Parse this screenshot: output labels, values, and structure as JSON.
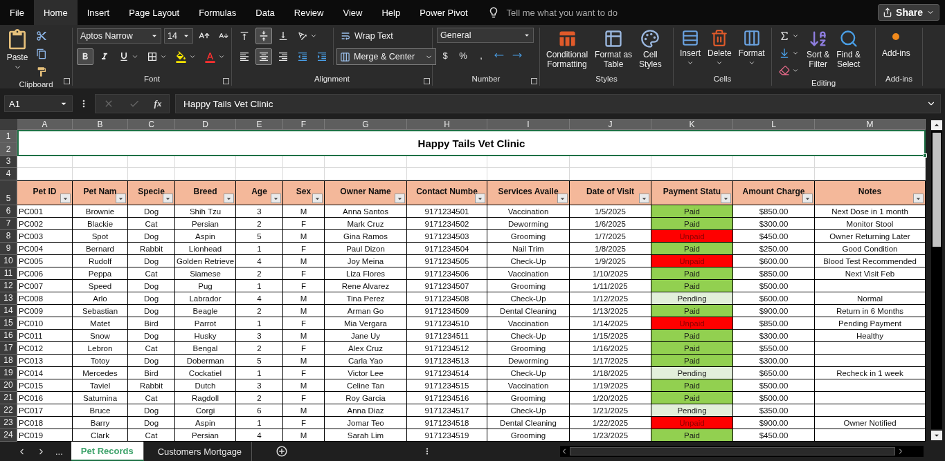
{
  "menu_tabs": [
    {
      "label": "File",
      "selected": false
    },
    {
      "label": "Home",
      "selected": true
    },
    {
      "label": "Insert",
      "selected": false
    },
    {
      "label": "Page Layout",
      "selected": false
    },
    {
      "label": "Formulas",
      "selected": false
    },
    {
      "label": "Data",
      "selected": false
    },
    {
      "label": "Review",
      "selected": false
    },
    {
      "label": "View",
      "selected": false
    },
    {
      "label": "Help",
      "selected": false
    },
    {
      "label": "Power Pivot",
      "selected": false
    }
  ],
  "tell_me": {
    "placeholder": "Tell me what you want to do"
  },
  "share_button": "Share",
  "ribbon": {
    "clipboard": {
      "label": "Clipboard",
      "paste": "Paste"
    },
    "font": {
      "label": "Font",
      "name": "Aptos Narrow",
      "size": "14",
      "bold": true,
      "italic": false,
      "underline": false
    },
    "alignment": {
      "label": "Alignment",
      "wrap_text": "Wrap Text",
      "merge": "Merge & Center",
      "vertical": [
        {
          "kind": "top",
          "selected": false
        },
        {
          "kind": "middle",
          "selected": true
        },
        {
          "kind": "bottom",
          "selected": false
        }
      ],
      "horizontal": [
        {
          "kind": "left",
          "selected": false
        },
        {
          "kind": "center",
          "selected": true
        },
        {
          "kind": "right",
          "selected": false
        }
      ]
    },
    "number": {
      "label": "Number",
      "format": "General",
      "symbols": [
        "$",
        "%",
        ","
      ]
    },
    "styles": {
      "label": "Styles",
      "buttons": [
        {
          "kind": "conditional",
          "lines": [
            "Conditional",
            "Formatting"
          ]
        },
        {
          "kind": "table",
          "lines": [
            "Format as",
            "Table"
          ]
        },
        {
          "kind": "cellstyles",
          "lines": [
            "Cell",
            "Styles"
          ]
        }
      ]
    },
    "cells": {
      "label": "Cells",
      "buttons": [
        {
          "kind": "insert",
          "label": "Insert"
        },
        {
          "kind": "delete",
          "label": "Delete"
        },
        {
          "kind": "format",
          "label": "Format"
        }
      ]
    },
    "editing": {
      "label": "Editing",
      "buttons": [
        {
          "kind": "sort",
          "lines": [
            "Sort &",
            "Filter"
          ]
        },
        {
          "kind": "find",
          "lines": [
            "Find &",
            "Select"
          ]
        }
      ]
    },
    "addins": {
      "label": "Add-ins",
      "button": "Add-ins"
    }
  },
  "formula_bar": {
    "name_box": "A1",
    "fx": "fx",
    "value": "Happy Tails Vet Clinic"
  },
  "columns": [
    {
      "letter": "A",
      "selected": true
    },
    {
      "letter": "B",
      "selected": true
    },
    {
      "letter": "C",
      "selected": true
    },
    {
      "letter": "D",
      "selected": true
    },
    {
      "letter": "E",
      "selected": true
    },
    {
      "letter": "F",
      "selected": true
    },
    {
      "letter": "G",
      "selected": true
    },
    {
      "letter": "H",
      "selected": true
    },
    {
      "letter": "I",
      "selected": true
    },
    {
      "letter": "J",
      "selected": true
    },
    {
      "letter": "K",
      "selected": true
    },
    {
      "letter": "L",
      "selected": true
    },
    {
      "letter": "M",
      "selected": true
    }
  ],
  "top_rows": [
    {
      "label": "1",
      "selected": true
    },
    {
      "label": "2",
      "selected": true
    },
    {
      "label": "3",
      "selected": false
    },
    {
      "label": "4",
      "selected": false
    },
    {
      "label": "5",
      "selected": false
    }
  ],
  "title": "Happy Tails Vet Clinic",
  "headers": [
    "Pet ID",
    "Pet Nam",
    "Specie",
    "Breed",
    "Age",
    "Sex",
    "Owner Name",
    "Contact Numbe",
    "Services Availe",
    "Date of Visit",
    "Payment Statu",
    "Amount Charge",
    "Notes"
  ],
  "rows": [
    {
      "row": "6",
      "selected": false,
      "color": "#92d050",
      "cells": [
        "PC001",
        "Brownie",
        "Dog",
        "Shih Tzu",
        "3",
        "M",
        "Anna Santos",
        "9171234501",
        "Vaccination",
        "1/5/2025",
        "Paid",
        "$850.00",
        "Next Dose in 1 month"
      ]
    },
    {
      "row": "7",
      "selected": false,
      "color": "#92d050",
      "cells": [
        "PC002",
        "Blackie",
        "Cat",
        "Persian",
        "2",
        "F",
        "Mark Cruz",
        "9171234502",
        "Deworming",
        "1/6/2025",
        "Paid",
        "$300.00",
        "Monitor Stool"
      ]
    },
    {
      "row": "8",
      "selected": false,
      "color": "#ff0000",
      "cells": [
        "PC003",
        "Spot",
        "Dog",
        "Aspin",
        "5",
        "M",
        "Gina Ramos",
        "9171234503",
        "Grooming",
        "1/7/2025",
        "Unpaid",
        "$450.00",
        "Owner Returning Later"
      ]
    },
    {
      "row": "9",
      "selected": false,
      "color": "#92d050",
      "cells": [
        "PC004",
        "Bernard",
        "Rabbit",
        "Lionhead",
        "1",
        "F",
        "Paul Dizon",
        "9171234504",
        "Nail Trim",
        "1/8/2025",
        "Paid",
        "$250.00",
        "Good Condition"
      ]
    },
    {
      "row": "10",
      "selected": false,
      "color": "#ff0000",
      "cells": [
        "PC005",
        "Rudolf",
        "Dog",
        "Golden Retrieve",
        "4",
        "M",
        "Joy Meina",
        "9171234505",
        "Check-Up",
        "1/9/2025",
        "Unpaid",
        "$600.00",
        "Blood Test Recommended"
      ]
    },
    {
      "row": "11",
      "selected": false,
      "color": "#92d050",
      "cells": [
        "PC006",
        "Peppa",
        "Cat",
        "Siamese",
        "2",
        "F",
        "Liza Flores",
        "9171234506",
        "Vaccination",
        "1/10/2025",
        "Paid",
        "$850.00",
        "Next Visit Feb"
      ]
    },
    {
      "row": "12",
      "selected": false,
      "color": "#92d050",
      "cells": [
        "PC007",
        "Speed",
        "Dog",
        "Pug",
        "1",
        "F",
        "Rene Alvarez",
        "9171234507",
        "Grooming",
        "1/11/2025",
        "Paid",
        "$500.00"
      ]
    },
    {
      "row": "13",
      "selected": false,
      "color": "#e2efda",
      "cells": [
        "PC008",
        "Arlo",
        "Dog",
        "Labrador",
        "4",
        "M",
        "Tina Perez",
        "9171234508",
        "Check-Up",
        "1/12/2025",
        "Pending",
        "$600.00",
        "Normal"
      ]
    },
    {
      "row": "14",
      "selected": false,
      "color": "#92d050",
      "cells": [
        "PC009",
        "Sebastian",
        "Dog",
        "Beagle",
        "2",
        "M",
        "Arman Go",
        "9171234509",
        "Dental Cleaning",
        "1/13/2025",
        "Paid",
        "$900.00",
        "Return in 6 Months"
      ]
    },
    {
      "row": "15",
      "selected": false,
      "color": "#ff0000",
      "cells": [
        "PC010",
        "Matet",
        "Bird",
        "Parrot",
        "1",
        "F",
        "Mia Vergara",
        "9171234510",
        "Vaccination",
        "1/14/2025",
        "Unpaid",
        "$850.00",
        "Pending Payment"
      ]
    },
    {
      "row": "16",
      "selected": false,
      "color": "#92d050",
      "cells": [
        "PC011",
        "Snow",
        "Dog",
        "Husky",
        "3",
        "M",
        "Jane Uy",
        "9171234511",
        "Check-Up",
        "1/15/2025",
        "Paid",
        "$300.00",
        "Healthy"
      ]
    },
    {
      "row": "17",
      "selected": false,
      "color": "#92d050",
      "cells": [
        "PC012",
        "Lebron",
        "Cat",
        "Bengal",
        "2",
        "F",
        "Alex Cruz",
        "9171234512",
        "Grooming",
        "1/16/2025",
        "Paid",
        "$550.00"
      ]
    },
    {
      "row": "18",
      "selected": false,
      "color": "#92d050",
      "cells": [
        "PC013",
        "Totoy",
        "Dog",
        "Doberman",
        "5",
        "M",
        "Carla Yao",
        "9171234513",
        "Deworming",
        "1/17/2025",
        "Paid",
        "$300.00"
      ]
    },
    {
      "row": "19",
      "selected": false,
      "color": "#e2efda",
      "cells": [
        "PC014",
        "Mercedes",
        "Bird",
        "Cockatiel",
        "1",
        "F",
        "Victor Lee",
        "9171234514",
        "Check-Up",
        "1/18/2025",
        "Pending",
        "$650.00",
        "Recheck in 1 week"
      ]
    },
    {
      "row": "20",
      "selected": false,
      "color": "#92d050",
      "cells": [
        "PC015",
        "Taviel",
        "Rabbit",
        "Dutch",
        "3",
        "M",
        "Celine Tan",
        "9171234515",
        "Vaccination",
        "1/19/2025",
        "Paid",
        "$500.00"
      ]
    },
    {
      "row": "21",
      "selected": false,
      "color": "#92d050",
      "cells": [
        "PC016",
        "Saturnina",
        "Cat",
        "Ragdoll",
        "2",
        "F",
        "Roy Garcia",
        "9171234516",
        "Grooming",
        "1/20/2025",
        "Paid",
        "$500.00"
      ]
    },
    {
      "row": "22",
      "selected": false,
      "color": "#e2efda",
      "cells": [
        "PC017",
        "Bruce",
        "Dog",
        "Corgi",
        "6",
        "M",
        "Anna Diaz",
        "9171234517",
        "Check-Up",
        "1/21/2025",
        "Pending",
        "$350.00"
      ]
    },
    {
      "row": "23",
      "selected": false,
      "color": "#ff0000",
      "cells": [
        "PC018",
        "Barry",
        "Dog",
        "Aspin",
        "1",
        "F",
        "Jomar Teo",
        "9171234518",
        "Dental Cleaning",
        "1/22/2025",
        "Unpaid",
        "$900.00",
        "Owner Notified"
      ]
    },
    {
      "row": "24",
      "selected": false,
      "color": "#92d050",
      "cells": [
        "PC019",
        "Clark",
        "Cat",
        "Persian",
        "4",
        "M",
        "Sarah Lim",
        "9171234519",
        "Grooming",
        "1/23/2025",
        "Paid",
        "$450.00"
      ]
    }
  ],
  "sheet_bar": {
    "more": "...",
    "tabs": [
      {
        "label": "Pet Records",
        "selected": true
      },
      {
        "label": "Customers Mortgage",
        "selected": false
      }
    ]
  }
}
